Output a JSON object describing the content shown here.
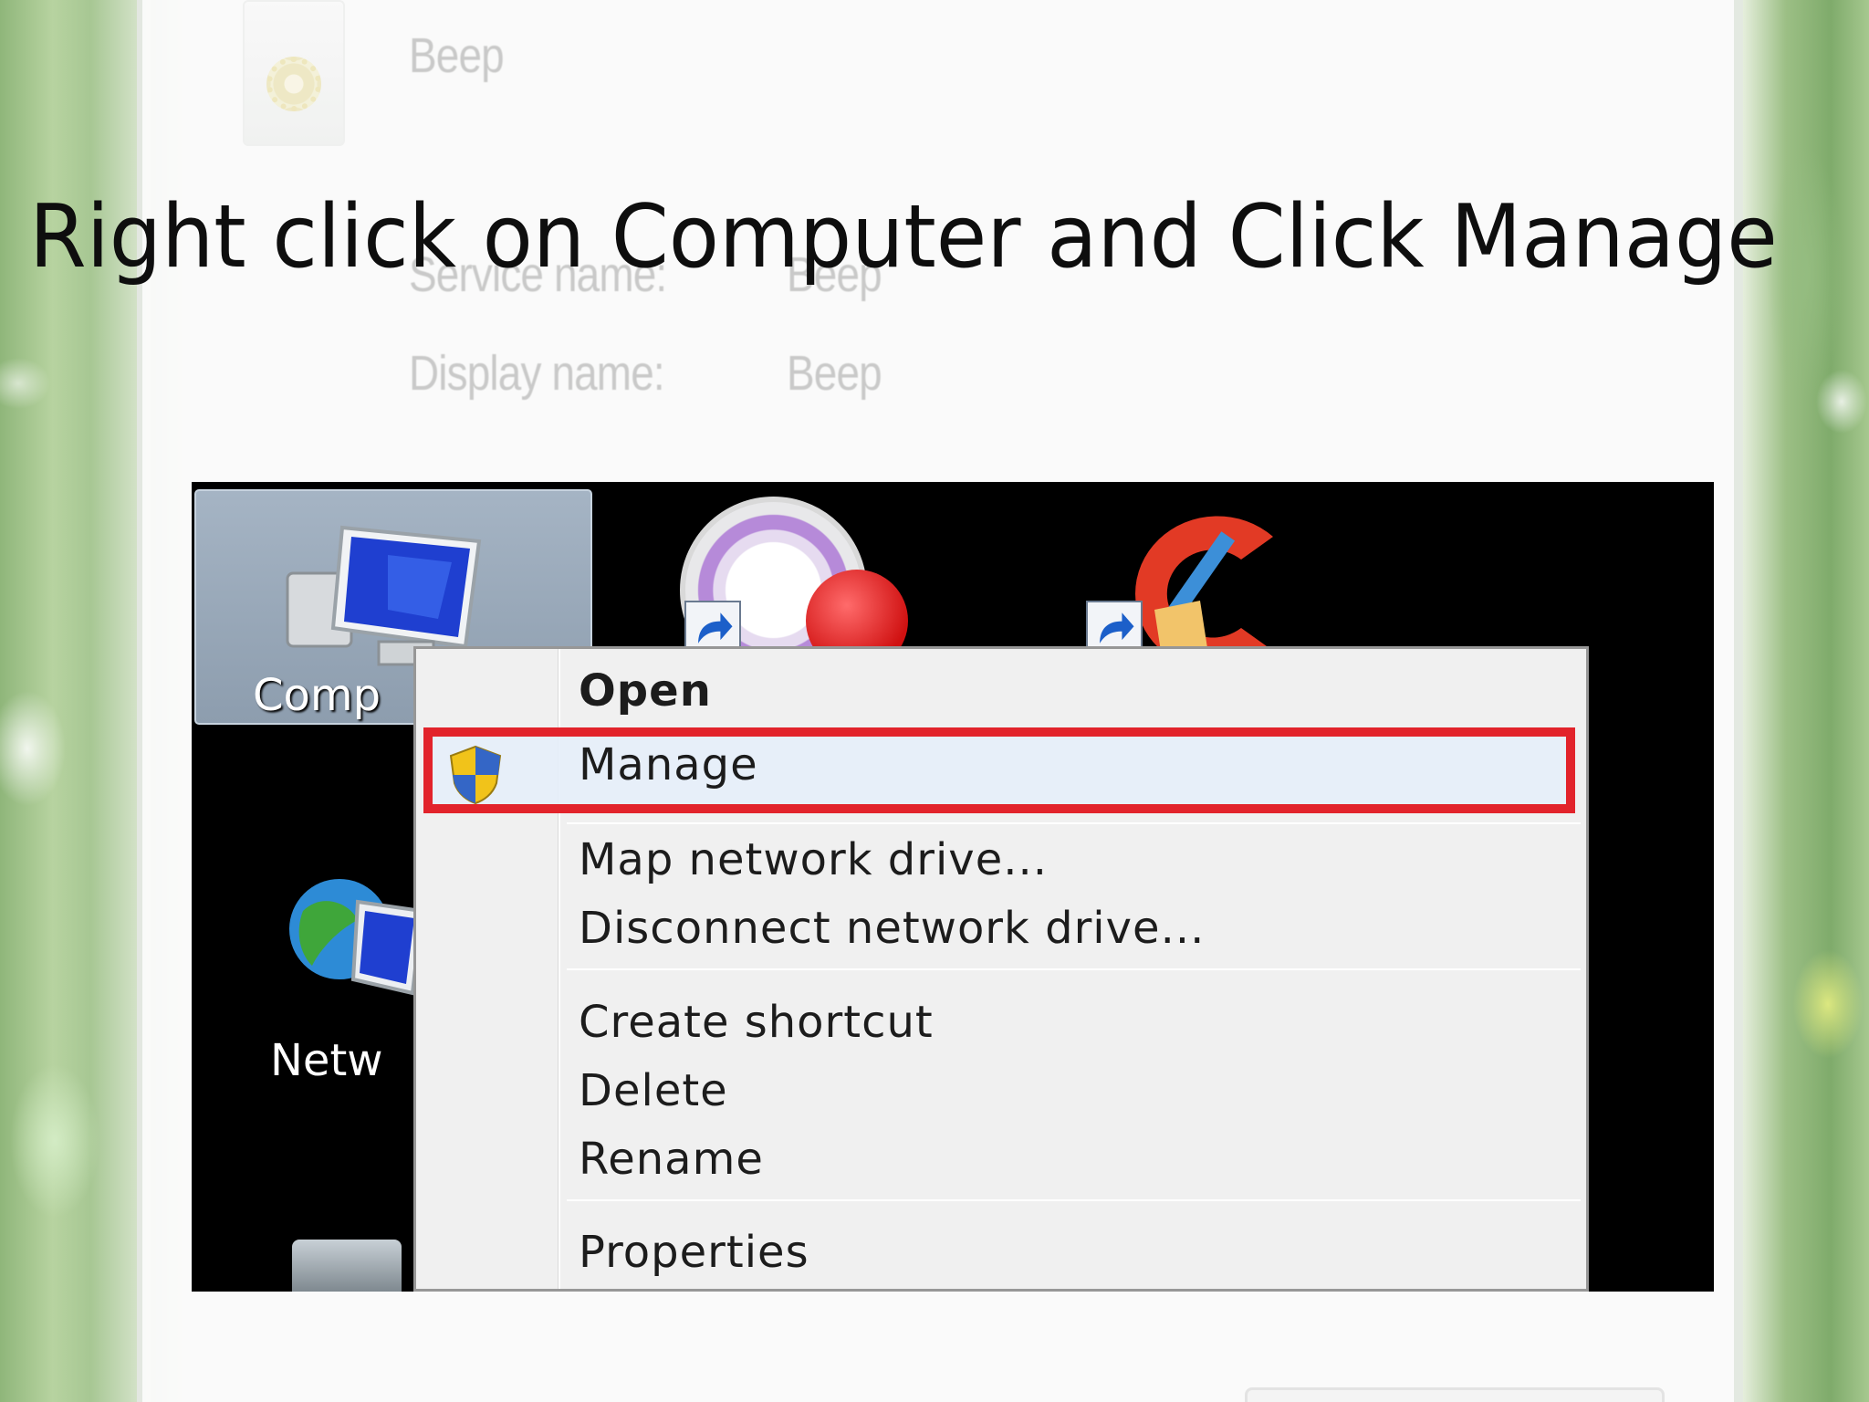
{
  "slide": {
    "title": "Right click on Computer and Click Manage"
  },
  "background_dialog": {
    "service_title": "Beep",
    "service_name_label": "Service name:",
    "service_name_value": "Beep",
    "display_name_label": "Display name:",
    "display_name_value": "Beep"
  },
  "desktop": {
    "computer_label": "Comp",
    "network_label": "Netw"
  },
  "context_menu": {
    "items": [
      {
        "label": "Open",
        "bold": true
      },
      {
        "label": "Manage",
        "highlighted": true,
        "icon": "shield-icon"
      },
      {
        "label": "Map network drive..."
      },
      {
        "label": "Disconnect network drive..."
      },
      {
        "label": "Create shortcut"
      },
      {
        "label": "Delete"
      },
      {
        "label": "Rename"
      },
      {
        "label": "Properties"
      }
    ]
  },
  "colors": {
    "highlight_border": "#e2232b",
    "menu_background": "#f0f0f0",
    "desktop_background": "#000000"
  }
}
